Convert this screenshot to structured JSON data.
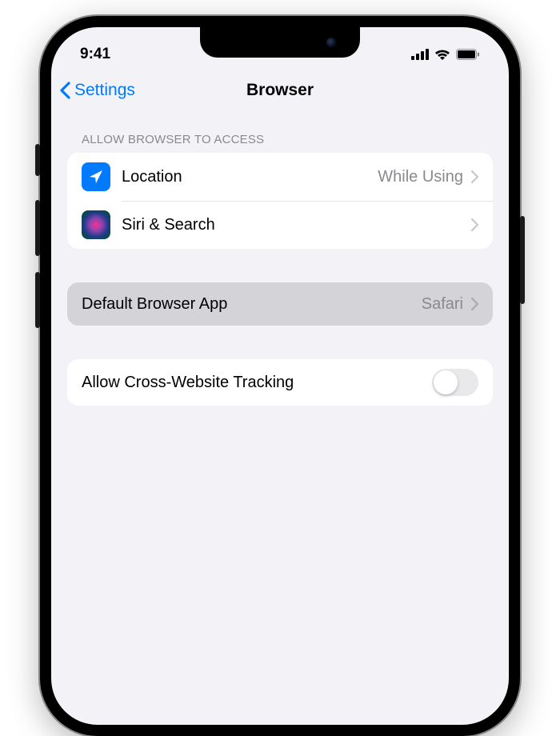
{
  "status": {
    "time": "9:41"
  },
  "nav": {
    "back_label": "Settings",
    "title": "Browser"
  },
  "sections": {
    "access": {
      "header": "Allow Browser to Access",
      "location": {
        "label": "Location",
        "value": "While Using"
      },
      "siri": {
        "label": "Siri & Search"
      }
    },
    "default_browser": {
      "label": "Default Browser App",
      "value": "Safari"
    },
    "tracking": {
      "label": "Allow Cross-Website Tracking",
      "enabled": false
    }
  }
}
